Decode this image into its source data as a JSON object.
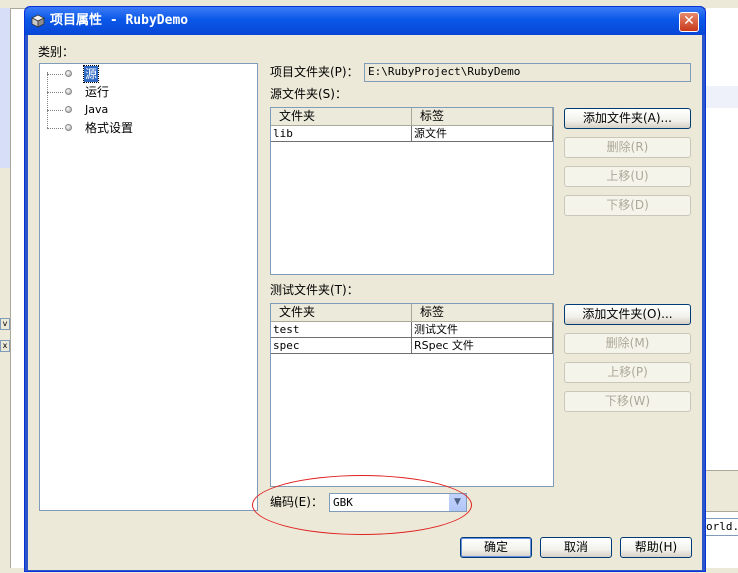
{
  "window": {
    "title": "项目属性 - RubyDemo",
    "close_glyph": "✕"
  },
  "categories": {
    "label": "类别：",
    "items": [
      {
        "label": "源",
        "selected": true
      },
      {
        "label": "运行",
        "selected": false
      },
      {
        "label": "Java",
        "selected": false
      },
      {
        "label": "格式设置",
        "selected": false
      }
    ]
  },
  "project_folder": {
    "label": "项目文件夹(P)：",
    "value": "E:\\RubyProject\\RubyDemo"
  },
  "source_folders": {
    "label": "源文件夹(S)：",
    "columns": [
      "文件夹",
      "标签"
    ],
    "rows": [
      {
        "folder": "lib",
        "label": "源文件"
      }
    ],
    "buttons": {
      "add": "添加文件夹(A)...",
      "remove": "删除(R)",
      "up": "上移(U)",
      "down": "下移(D)"
    }
  },
  "test_folders": {
    "label": "测试文件夹(T)：",
    "columns": [
      "文件夹",
      "标签"
    ],
    "rows": [
      {
        "folder": "test",
        "label": "测试文件"
      },
      {
        "folder": "spec",
        "label": "RSpec 文件"
      }
    ],
    "buttons": {
      "add": "添加文件夹(O)...",
      "remove": "删除(M)",
      "up": "上移(P)",
      "down": "下移(W)"
    }
  },
  "encoding": {
    "label": "编码(E)：",
    "value": "GBK"
  },
  "footer": {
    "ok": "确定",
    "cancel": "取消",
    "help": "帮助(H)"
  },
  "background": {
    "editor_fragment": "orld.r",
    "left_btn_1": "v",
    "left_btn_2": "x"
  },
  "colors": {
    "titlebar": "#0a58e8",
    "selection": "#316ac5",
    "annotation": "#e02020"
  }
}
